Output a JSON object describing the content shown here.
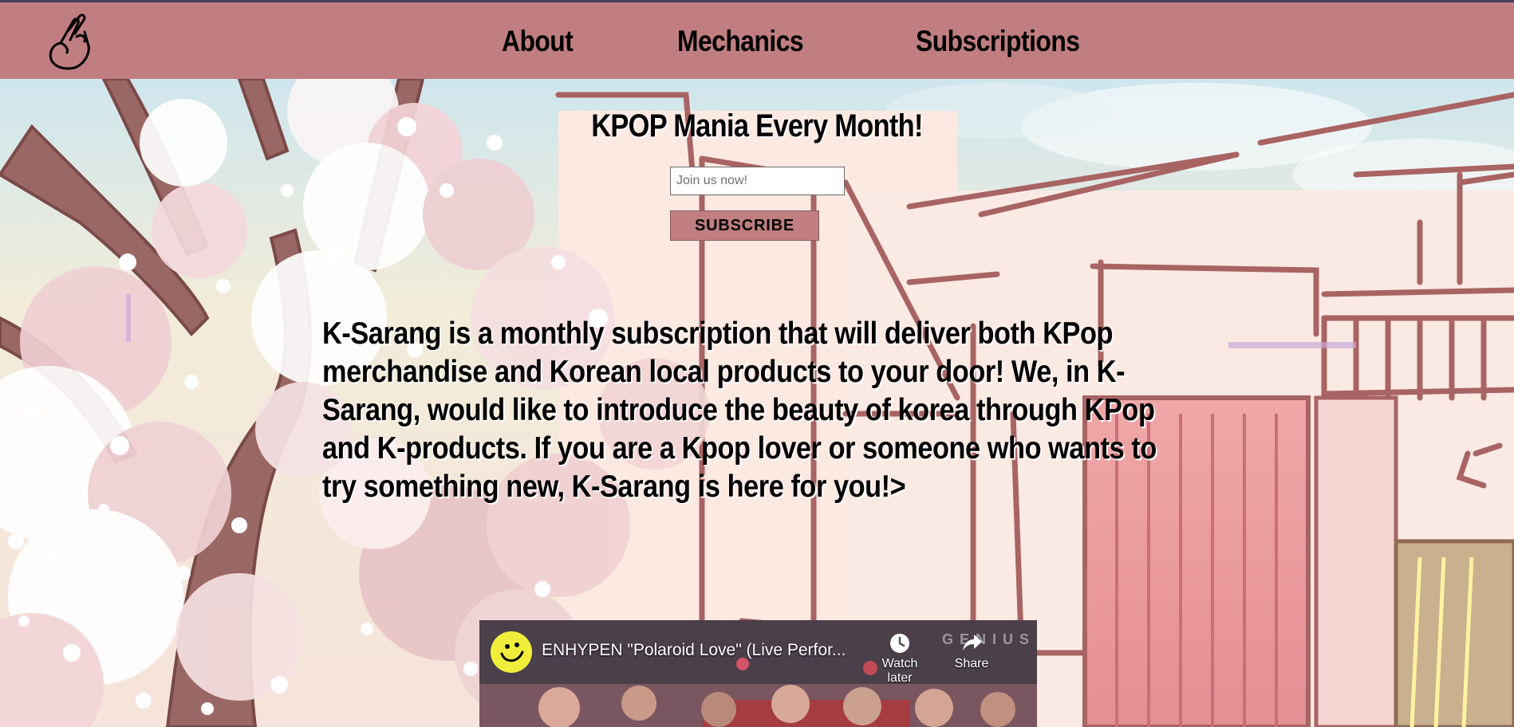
{
  "nav": {
    "logo_icon": "finger-heart-icon",
    "about": "About",
    "mechanics": "Mechanics",
    "subscriptions": "Subscriptions"
  },
  "hero": {
    "title": "KPOP Mania Every Month!",
    "email_placeholder": "Join us now!",
    "subscribe_label": "SUBSCRIBE",
    "intro": "K-Sarang is a monthly subscription that will deliver both KPop merchandise and Korean local products to your door! We, in K-Sarang, would like to introduce the beauty of korea through KPop and K-products. If you are a Kpop lover or someone who wants to try something new, K-Sarang is here for you!>"
  },
  "video": {
    "title": "ENHYPEN \"Polaroid Love\" (Live Perfor...",
    "watch_later": "Watch later",
    "share": "Share",
    "watermark": "GENIUS"
  },
  "colors": {
    "header": "#c07e80",
    "header_border": "#4b3b55",
    "button": "#c07e80"
  }
}
